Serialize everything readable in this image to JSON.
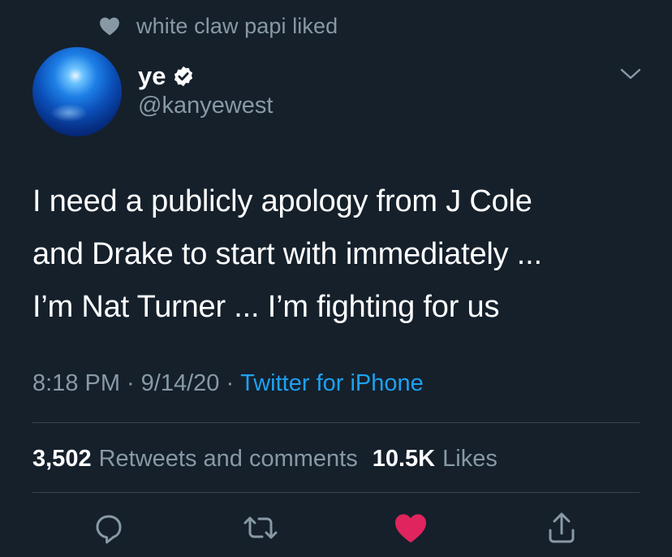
{
  "social_context": {
    "icon": "heart-icon",
    "text": "white claw papi liked"
  },
  "author": {
    "display_name": "ye",
    "verified": true,
    "handle": "@kanyewest"
  },
  "tweet": {
    "lines": [
      "I need a publicly apology from J Cole",
      "and Drake to start with immediately ...",
      "I’m Nat Turner ... I’m fighting for us"
    ]
  },
  "meta": {
    "time": "8:18 PM",
    "separator": "·",
    "date": "9/14/20",
    "source": "Twitter for iPhone"
  },
  "stats": {
    "retweets_count": "3,502",
    "retweets_label": "Retweets and comments",
    "likes_count": "10.5K",
    "likes_label": "Likes"
  },
  "actions": [
    "reply-icon",
    "retweet-icon",
    "like-icon",
    "share-icon"
  ],
  "colors": {
    "background": "#15202b",
    "secondary_text": "#8899a6",
    "link": "#1da1f2",
    "like_active": "#e0245e",
    "divider": "#38444d"
  }
}
